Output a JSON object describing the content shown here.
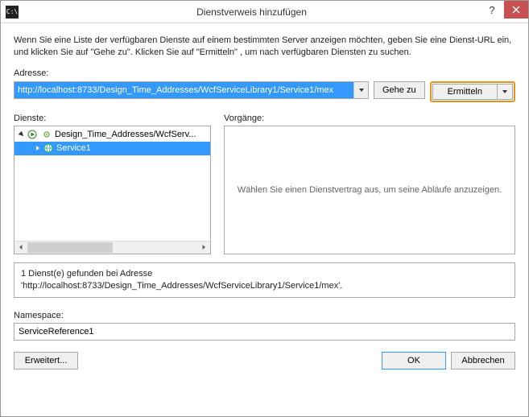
{
  "window": {
    "title": "Dienstverweis hinzufügen"
  },
  "intro": "Wenn Sie eine Liste der verfügbaren Dienste auf einem bestimmten Server anzeigen möchten, geben Sie eine Dienst-URL ein, und klicken Sie auf \"Gehe zu\". Klicken Sie auf \"Ermitteln\" , um nach verfügbaren Diensten zu suchen.",
  "address": {
    "label": "Adresse:",
    "value": "http://localhost:8733/Design_Time_Addresses/WcfServiceLibrary1/Service1/mex",
    "go_label": "Gehe zu",
    "discover_label": "Ermitteln"
  },
  "services": {
    "label": "Dienste:",
    "tree": {
      "root_label": "Design_Time_Addresses/WcfServ...",
      "child_label": "Service1"
    }
  },
  "operations": {
    "label": "Vorgänge:",
    "placeholder": "Wählen Sie einen Dienstvertrag aus, um seine Abläufe anzuzeigen."
  },
  "status": {
    "line1": "1 Dienst(e) gefunden bei Adresse",
    "line2": "'http://localhost:8733/Design_Time_Addresses/WcfServiceLibrary1/Service1/mex'."
  },
  "namespace": {
    "label": "Namespace:",
    "value": "ServiceReference1"
  },
  "footer": {
    "advanced_label": "Erweitert...",
    "ok_label": "OK",
    "cancel_label": "Abbrechen"
  }
}
